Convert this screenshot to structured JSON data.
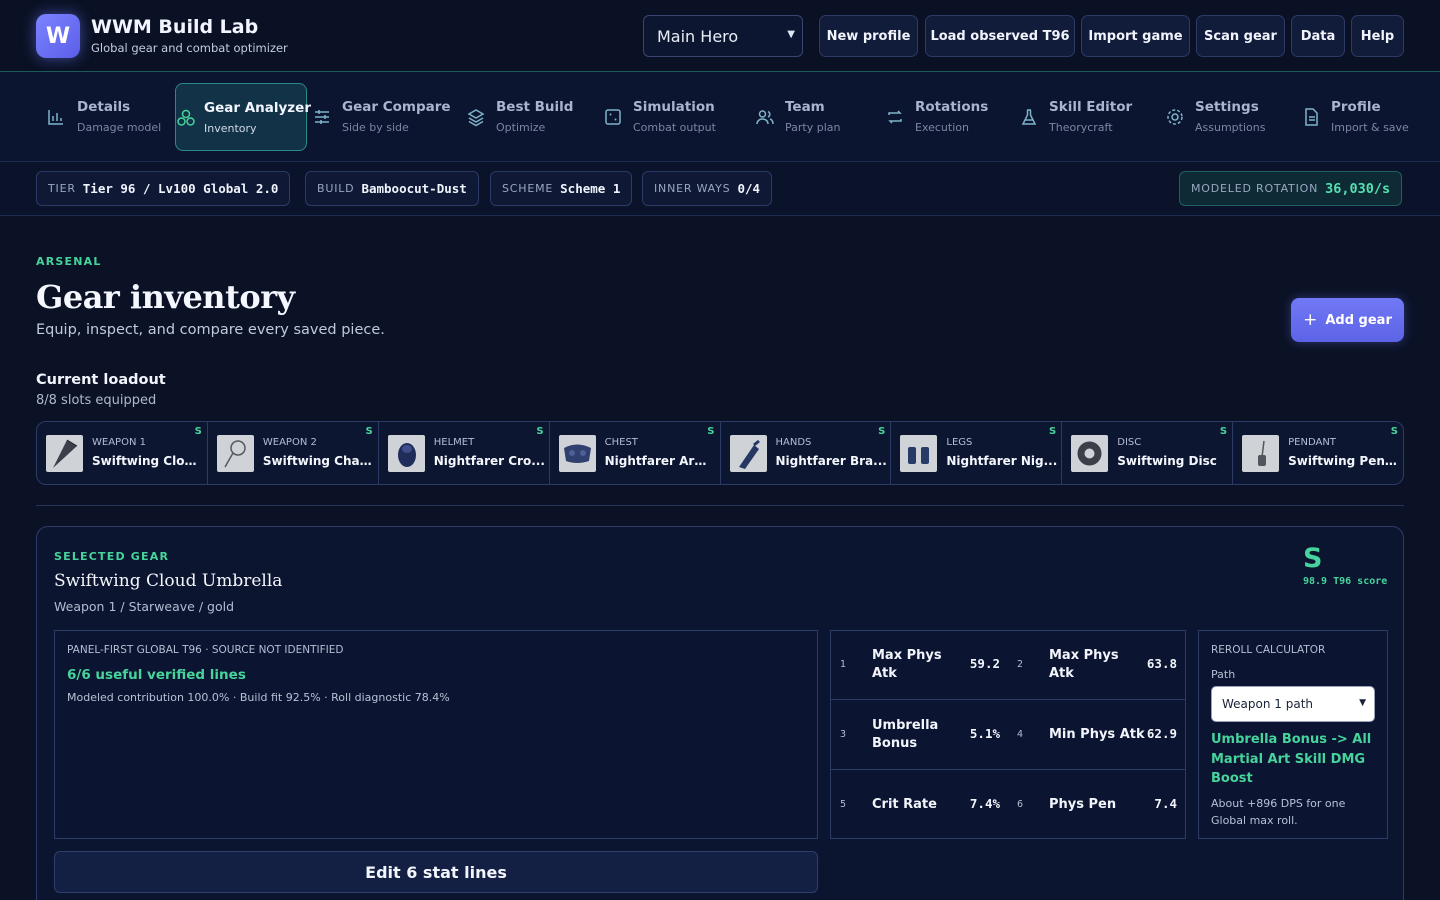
{
  "app": {
    "logo_letter": "W",
    "title": "WWM Build Lab",
    "subtitle": "Global gear and combat optimizer"
  },
  "toolbar": {
    "profile_select": "Main Hero",
    "buttons": [
      "New profile",
      "Load observed T96",
      "Import game",
      "Scan gear",
      "Data",
      "Help"
    ]
  },
  "nav": {
    "items": [
      {
        "label": "Details",
        "sub": "Damage model",
        "icon": "bar-chart-icon"
      },
      {
        "label": "Gear Analyzer",
        "sub": "Inventory",
        "icon": "gear-cluster-icon",
        "active": true
      },
      {
        "label": "Gear Compare",
        "sub": "Side by side",
        "icon": "sliders-icon"
      },
      {
        "label": "Best Build",
        "sub": "Optimize",
        "icon": "layers-icon"
      },
      {
        "label": "Simulation",
        "sub": "Combat output",
        "icon": "dice-icon"
      },
      {
        "label": "Team",
        "sub": "Party plan",
        "icon": "users-icon"
      },
      {
        "label": "Rotations",
        "sub": "Execution",
        "icon": "repeat-icon"
      },
      {
        "label": "Skill Editor",
        "sub": "Theorycraft",
        "icon": "flask-icon"
      },
      {
        "label": "Settings",
        "sub": "Assumptions",
        "icon": "cog-icon"
      },
      {
        "label": "Profile",
        "sub": "Import & save",
        "icon": "document-icon"
      }
    ]
  },
  "status": {
    "tier_key": "TIER",
    "tier_val": "Tier 96 / Lv100 Global 2.0",
    "build_key": "BUILD",
    "build_val": "Bamboocut-Dust",
    "scheme_key": "SCHEME",
    "scheme_val": "Scheme 1",
    "inner_key": "INNER WAYS",
    "inner_val": "0/4",
    "rotation_key": "MODELED ROTATION",
    "rotation_val": "36,030/s"
  },
  "page": {
    "eyebrow": "ARSENAL",
    "title": "Gear inventory",
    "subtitle": "Equip, inspect, and compare every saved piece.",
    "add_button": "Add gear",
    "loadout_title": "Current loadout",
    "loadout_sub": "8/8 slots equipped"
  },
  "slots": [
    {
      "type": "WEAPON 1",
      "name": "Swiftwing Clou...",
      "rank": "S"
    },
    {
      "type": "WEAPON 2",
      "name": "Swiftwing Charm",
      "rank": "S"
    },
    {
      "type": "HELMET",
      "name": "Nightfarer Cro...",
      "rank": "S"
    },
    {
      "type": "CHEST",
      "name": "Nightfarer Armor",
      "rank": "S"
    },
    {
      "type": "HANDS",
      "name": "Nightfarer Bra...",
      "rank": "S"
    },
    {
      "type": "LEGS",
      "name": "Nightfarer Nig...",
      "rank": "S"
    },
    {
      "type": "DISC",
      "name": "Swiftwing Disc",
      "rank": "S"
    },
    {
      "type": "PENDANT",
      "name": "Swiftwing Pend...",
      "rank": "S"
    }
  ],
  "selected": {
    "eyebrow": "SELECTED GEAR",
    "name": "Swiftwing Cloud Umbrella",
    "meta": "Weapon 1 / Starweave / gold",
    "rank": "S",
    "score": "98.9 T96 score",
    "diag_head": "PANEL-FIRST GLOBAL T96 · SOURCE NOT IDENTIFIED",
    "diag_lines": "6/6 useful verified lines",
    "diag_note": "Modeled contribution 100.0% · Build fit 92.5% · Roll diagnostic 78.4%",
    "stats": [
      {
        "n": "1",
        "name": "Max Phys Atk",
        "val": "59.2"
      },
      {
        "n": "2",
        "name": "Max Phys Atk",
        "val": "63.8"
      },
      {
        "n": "3",
        "name": "Umbrella Bonus",
        "val": "5.1%"
      },
      {
        "n": "4",
        "name": "Min Phys Atk",
        "val": "62.9"
      },
      {
        "n": "5",
        "name": "Crit Rate",
        "val": "7.4%"
      },
      {
        "n": "6",
        "name": "Phys Pen",
        "val": "7.4"
      }
    ],
    "reroll_head": "REROLL CALCULATOR",
    "reroll_path_label": "Path",
    "reroll_path": "Weapon 1 path",
    "reroll_result": "Umbrella Bonus -> All Martial Art Skill DMG Boost",
    "reroll_note": "About +896 DPS for one Global max roll.",
    "edit_button": "Edit 6 stat lines"
  },
  "colors": {
    "accent": "#46d49c",
    "brand": "#6a71f0",
    "background": "#0b1226"
  }
}
